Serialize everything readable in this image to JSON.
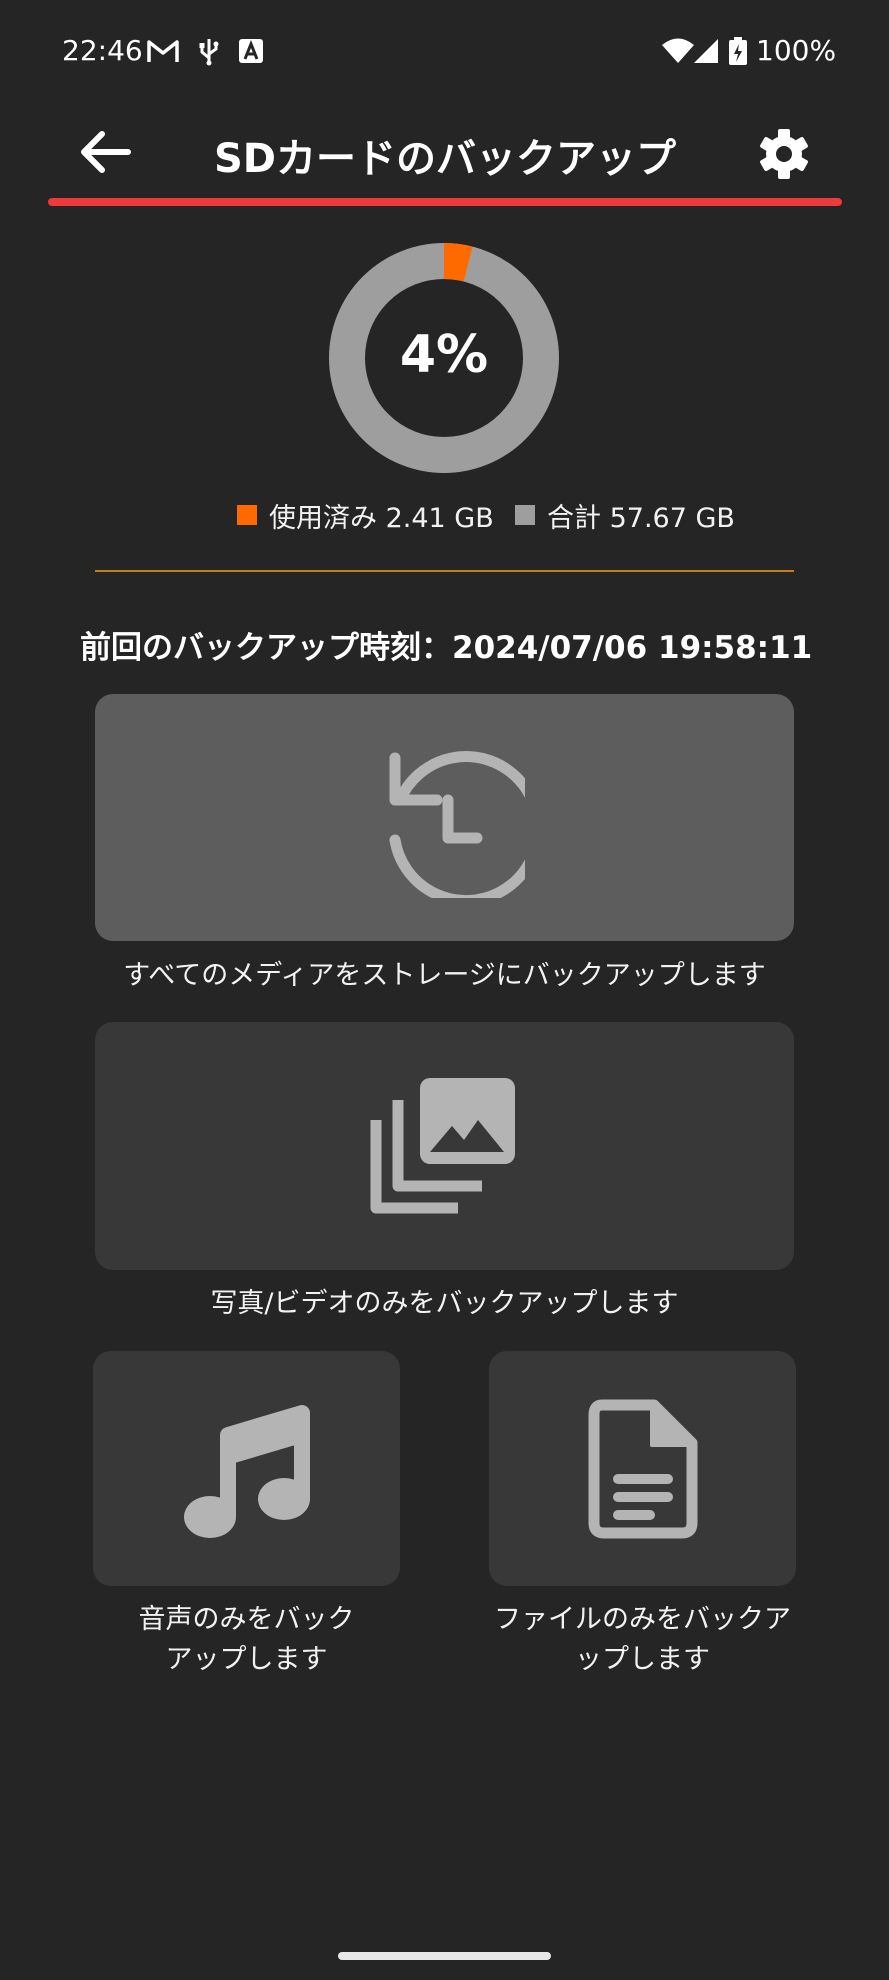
{
  "status_bar": {
    "time": "22:46",
    "battery": "100%",
    "icons": [
      "gmail-icon",
      "usb-icon",
      "a-notification-icon",
      "wifi-icon",
      "signal-icon",
      "battery-charging-icon"
    ]
  },
  "app_bar": {
    "title": "SDカードのバックアップ",
    "back_icon": "arrow-left-icon",
    "settings_icon": "gear-icon",
    "underline_color": "#ee3a3a"
  },
  "storage": {
    "percent_label": "4%",
    "used_fraction": 0.04,
    "used_legend": "使用済み 2.41 GB",
    "total_legend": "合計 57.67 GB",
    "used_color": "#ff6a00",
    "total_color": "#9e9e9e"
  },
  "last_backup": {
    "text": "前回のバックアップ時刻：2024/07/06 19:58:11"
  },
  "actions": {
    "all_media": {
      "label": "すべてのメディアをストレージにバックアップします",
      "icon": "history-icon"
    },
    "photos_videos": {
      "label": "写真/ビデオのみをバックアップします",
      "icon": "photo-library-icon"
    },
    "audio": {
      "label_line1": "音声のみをバック",
      "label_line2": "アップします",
      "icon": "music-note-icon"
    },
    "files": {
      "label_line1": "ファイルのみをバックア",
      "label_line2": "ップします",
      "icon": "document-icon"
    }
  },
  "colors": {
    "background": "#252525",
    "card_primary": "#5d5d5d",
    "card_secondary": "#383838",
    "icon_gray": "#b4b4b4",
    "divider": "#c67a22"
  }
}
